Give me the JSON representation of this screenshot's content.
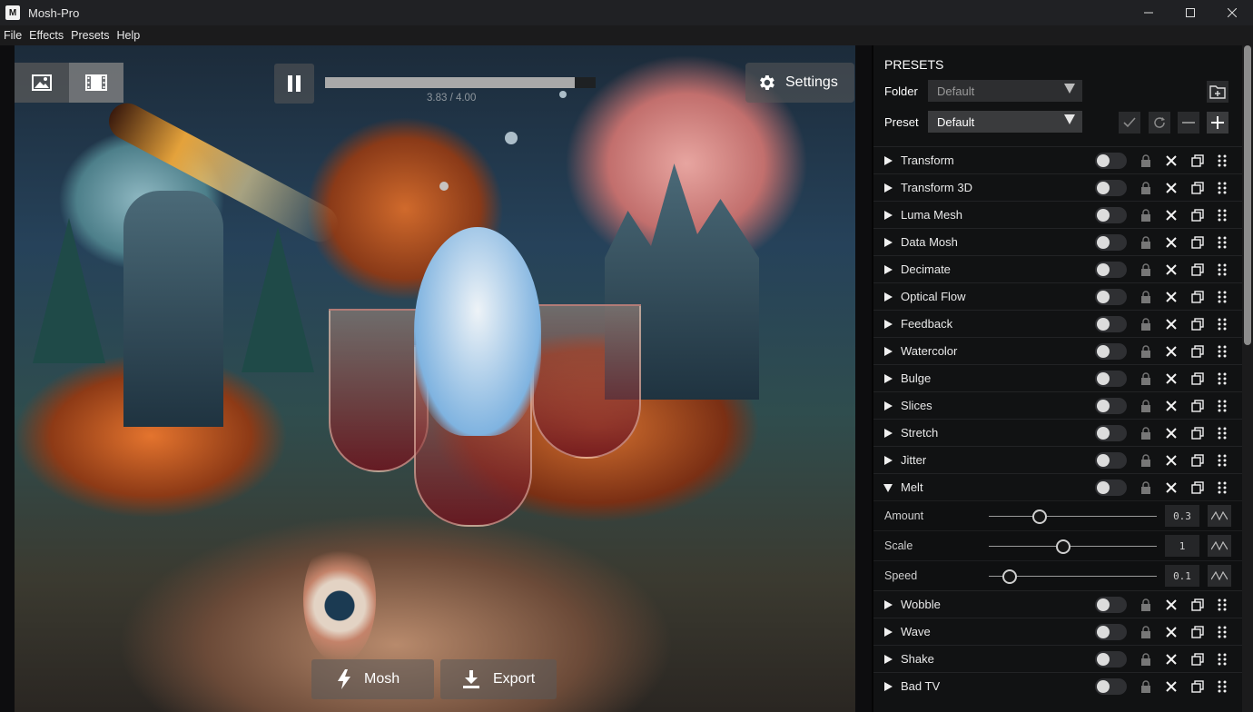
{
  "window": {
    "title": "Mosh-Pro",
    "icon_letter": "M"
  },
  "menu": [
    "File",
    "Effects",
    "Presets",
    "Help"
  ],
  "player": {
    "time": "3.83 / 4.00",
    "progress": 0.957,
    "settings_label": "Settings"
  },
  "actions": {
    "mosh_label": "Mosh",
    "export_label": "Export"
  },
  "presets_panel": {
    "title": "PRESETS",
    "folder_label": "Folder",
    "folder_value": "Default",
    "preset_label": "Preset",
    "preset_value": "Default"
  },
  "effects": [
    {
      "name": "Transform",
      "expanded": false,
      "enabled": false
    },
    {
      "name": "Transform 3D",
      "expanded": false,
      "enabled": false
    },
    {
      "name": "Luma Mesh",
      "expanded": false,
      "enabled": false
    },
    {
      "name": "Data Mosh",
      "expanded": false,
      "enabled": false
    },
    {
      "name": "Decimate",
      "expanded": false,
      "enabled": false
    },
    {
      "name": "Optical Flow",
      "expanded": false,
      "enabled": false
    },
    {
      "name": "Feedback",
      "expanded": false,
      "enabled": false
    },
    {
      "name": "Watercolor",
      "expanded": false,
      "enabled": false
    },
    {
      "name": "Bulge",
      "expanded": false,
      "enabled": false
    },
    {
      "name": "Slices",
      "expanded": false,
      "enabled": false
    },
    {
      "name": "Stretch",
      "expanded": false,
      "enabled": false
    },
    {
      "name": "Jitter",
      "expanded": false,
      "enabled": false
    },
    {
      "name": "Melt",
      "expanded": true,
      "enabled": false
    },
    {
      "name": "Wobble",
      "expanded": false,
      "enabled": false
    },
    {
      "name": "Wave",
      "expanded": false,
      "enabled": false
    },
    {
      "name": "Shake",
      "expanded": false,
      "enabled": false
    },
    {
      "name": "Bad TV",
      "expanded": false,
      "enabled": false
    }
  ],
  "melt_params": [
    {
      "label": "Amount",
      "value": "0.3",
      "slider_fraction": 0.31
    },
    {
      "label": "Scale",
      "value": "1",
      "slider_fraction": 0.45
    },
    {
      "label": "Speed",
      "value": "0.1",
      "slider_fraction": 0.13
    }
  ]
}
